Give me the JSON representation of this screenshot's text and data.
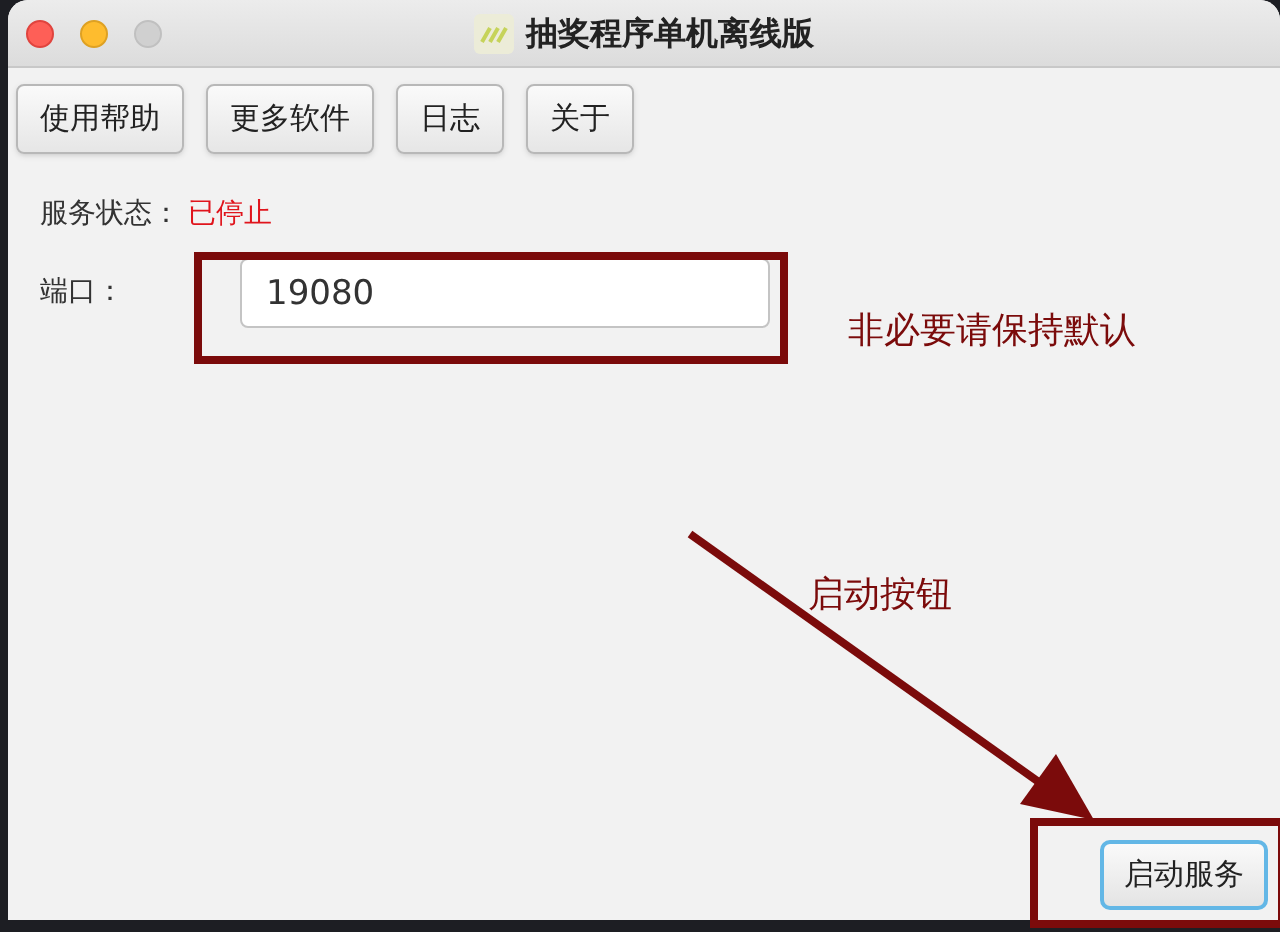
{
  "window": {
    "title": "抽奖程序单机离线版"
  },
  "toolbar": [
    {
      "label": "使用帮助"
    },
    {
      "label": "更多软件"
    },
    {
      "label": "日志"
    },
    {
      "label": "关于"
    }
  ],
  "status": {
    "label": "服务状态：",
    "value": "已停止"
  },
  "port": {
    "label": "端口：",
    "value": "19080"
  },
  "start_button": {
    "label": "启动服务"
  },
  "annotations": [
    {
      "kind": "box-note",
      "text": "非必要请保持默认"
    },
    {
      "kind": "arrow-note",
      "text": "启动按钮"
    }
  ]
}
